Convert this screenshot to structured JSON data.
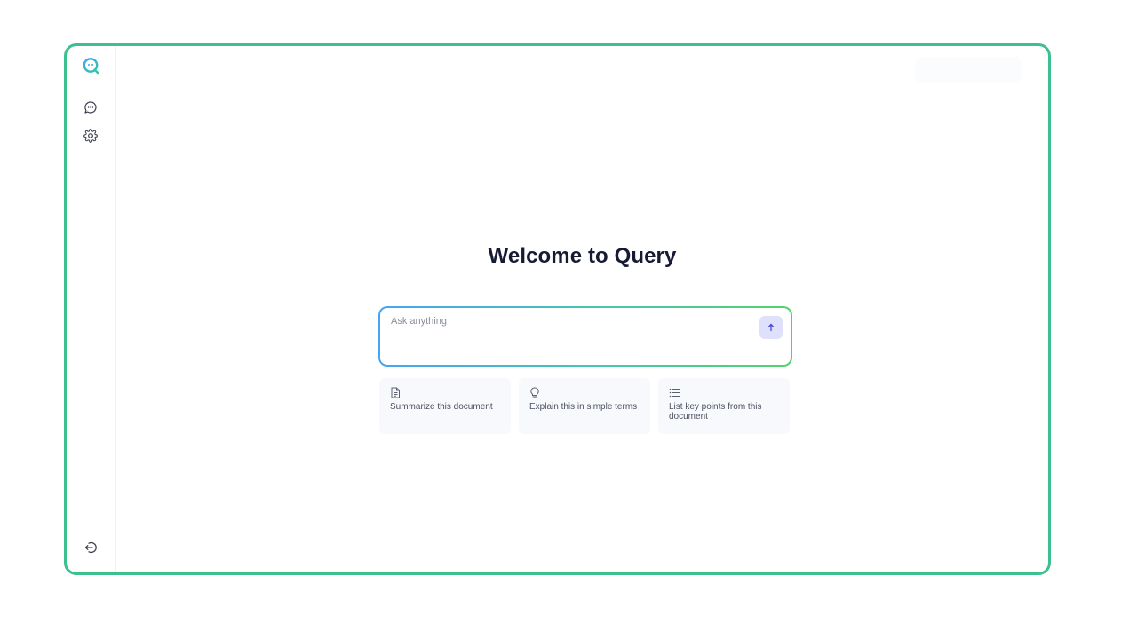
{
  "app": {
    "title": "Welcome to Query",
    "accent_color": "#3cc08f"
  },
  "sidebar": {
    "logo_icon": "query-logo-icon",
    "items": [
      {
        "icon": "chat-bubble-icon"
      },
      {
        "icon": "gear-icon"
      }
    ],
    "bottom_icon": "logout-icon"
  },
  "search": {
    "placeholder": "Ask anything",
    "value": "",
    "send_icon": "arrow-up-icon"
  },
  "suggestions": [
    {
      "icon": "document-icon",
      "label": "Summarize this document"
    },
    {
      "icon": "lightbulb-icon",
      "label": "Explain this in simple terms"
    },
    {
      "icon": "list-icon",
      "label": "List key points from this document"
    }
  ]
}
